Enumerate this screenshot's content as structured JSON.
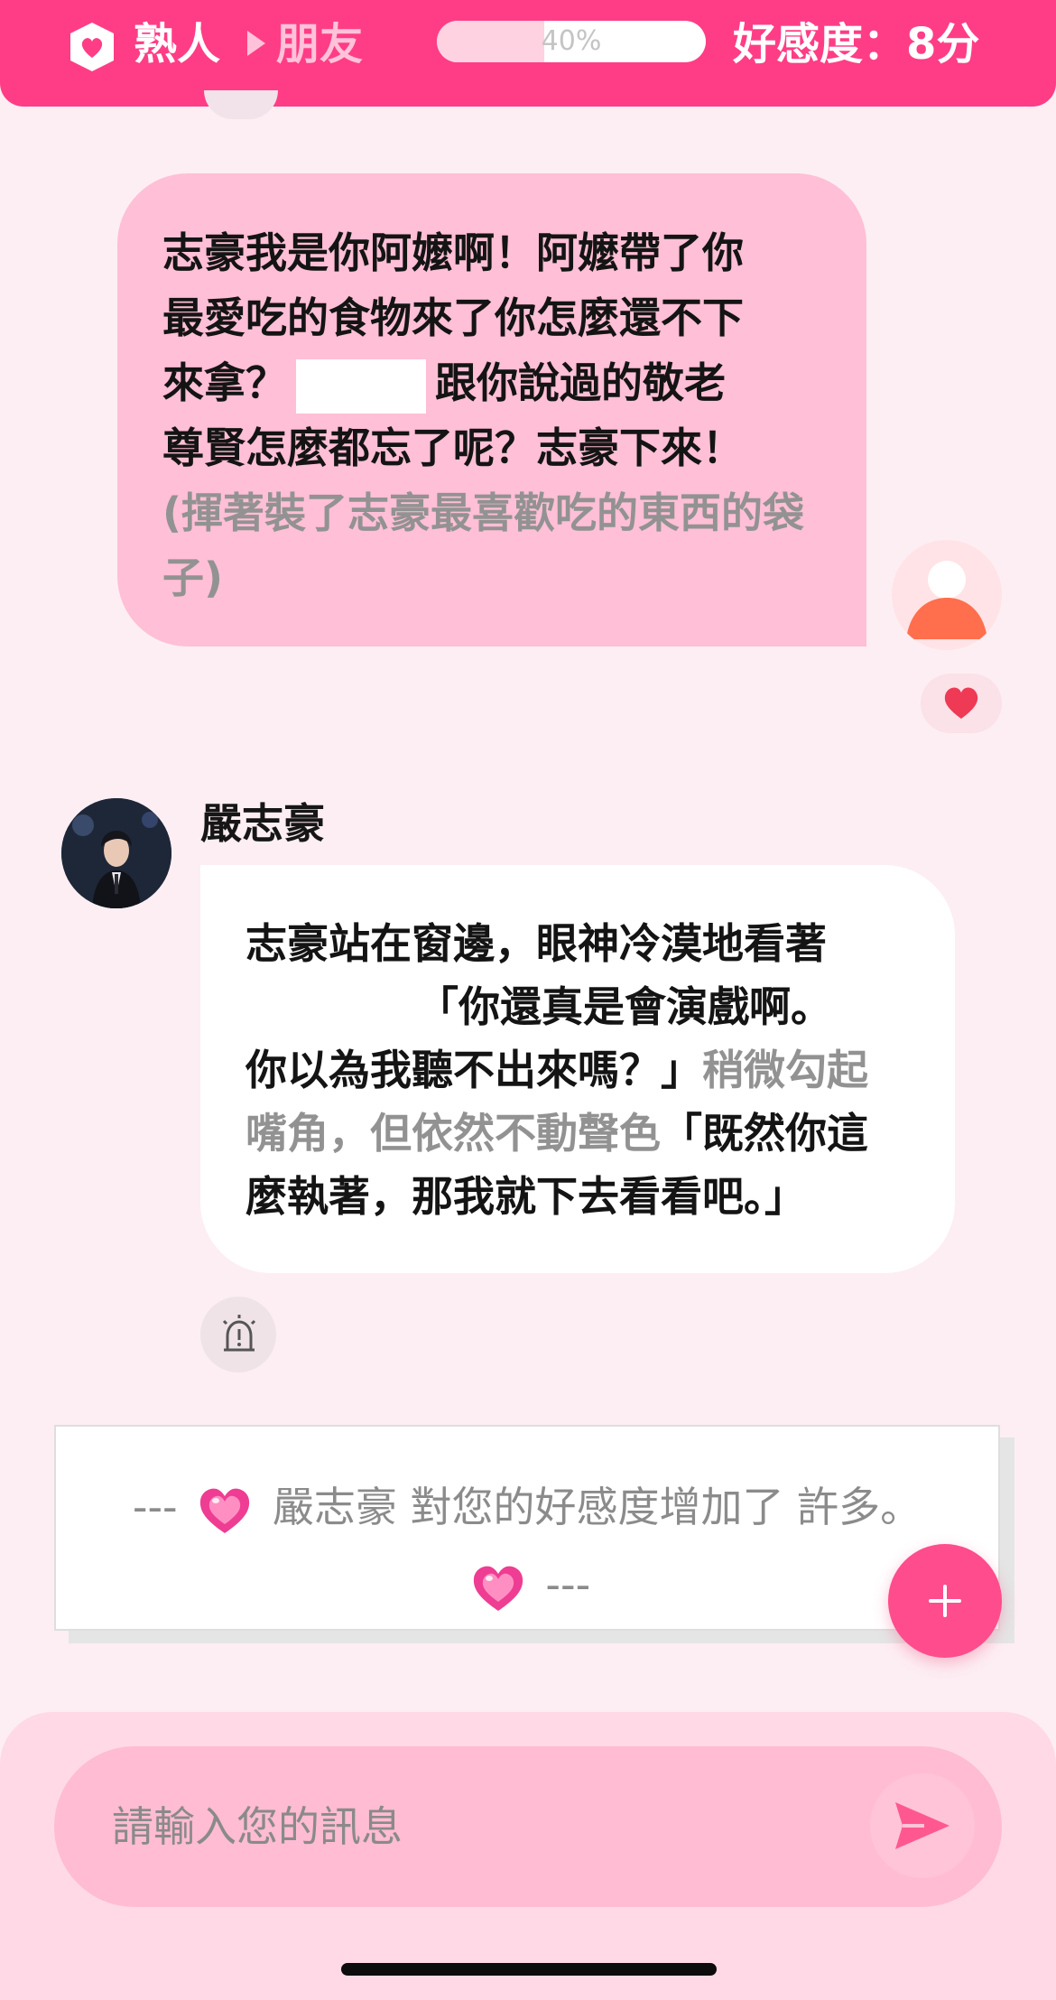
{
  "header": {
    "relation_from": "熟人",
    "relation_to": "朋友",
    "progress_label": "40%",
    "progress_fraction": 0.4,
    "affinity_text": "好感度：8分"
  },
  "messages": {
    "user_message": {
      "line1": "志豪我是你阿嬤啊！阿嬤帶了你",
      "line2": "最愛吃的食物來了你怎麼還不下",
      "line3_start": "來拿？",
      "line3_end": "跟你說過的敬老",
      "line4": "尊賢怎麼都忘了呢？志豪下來！",
      "action": "(揮著裝了志豪最喜歡吃的東西的袋子)"
    },
    "character_message": {
      "name": "嚴志豪",
      "line1": "志豪站在窗邊，眼神冷漠地看著",
      "line2_after_mask": "「你還真是會演戲啊。",
      "line3_dialog": "你以為我聽不出來嗎？」",
      "line3_action": "稍微勾起",
      "line4_action": "嘴角，但依然不動聲色",
      "line4_dialog": "「既然你這",
      "line5": "麼執著，那我就下去看看吧。」"
    }
  },
  "notice": {
    "prefix": "---",
    "text": "嚴志豪 對您的好感度增加了 許多。",
    "suffix": "---"
  },
  "composer": {
    "placeholder": "請輸入您的訊息"
  },
  "colors": {
    "primary": "#ff3d86",
    "user_bubble": "#ffbfd6",
    "background": "#fdeef3"
  },
  "icons": {
    "header": "shield-heart-icon",
    "user_avatar": "user-silhouette-icon",
    "like": "heart-icon",
    "alert": "alarm-light-icon",
    "fab": "plus-icon",
    "send": "send-icon"
  }
}
